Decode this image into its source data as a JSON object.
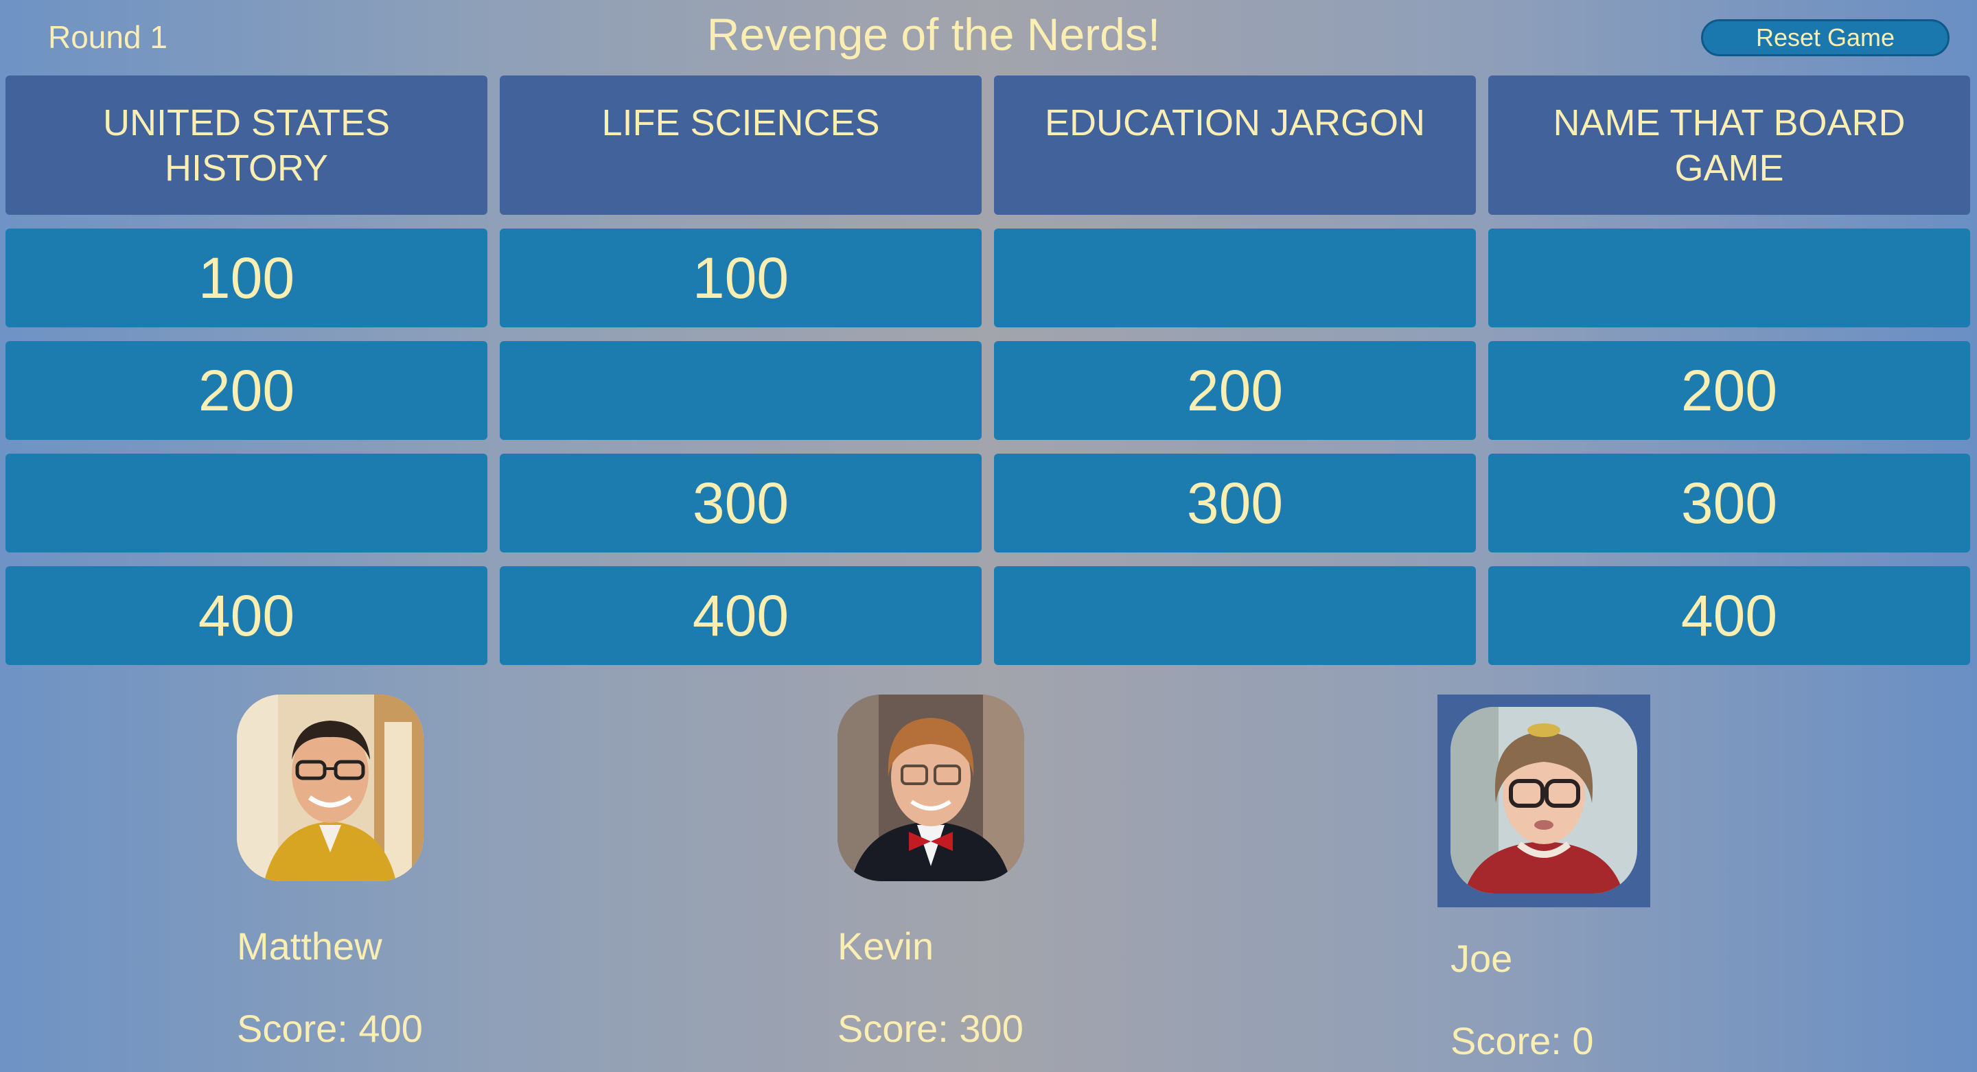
{
  "header": {
    "round_label": "Round 1",
    "title": "Revenge of the Nerds!",
    "reset_label": "Reset Game"
  },
  "board": {
    "categories": [
      "UNITED STATES HISTORY",
      "LIFE SCIENCES",
      "EDUCATION JARGON",
      "NAME THAT BOARD GAME"
    ],
    "rows": [
      [
        "100",
        "100",
        "",
        ""
      ],
      [
        "200",
        "",
        "200",
        "200"
      ],
      [
        "",
        "300",
        "300",
        "300"
      ],
      [
        "400",
        "400",
        "",
        "400"
      ]
    ]
  },
  "players": [
    {
      "name": "Matthew",
      "score_label": "Score: 400",
      "active": false
    },
    {
      "name": "Kevin",
      "score_label": "Score: 300",
      "active": false
    },
    {
      "name": "Joe",
      "score_label": "Score: 0",
      "active": true
    }
  ],
  "colors": {
    "text": "#fbeeb2",
    "category_bg": "#41629a",
    "tile_bg": "#1c7caf",
    "button_bg": "#1b78af"
  }
}
